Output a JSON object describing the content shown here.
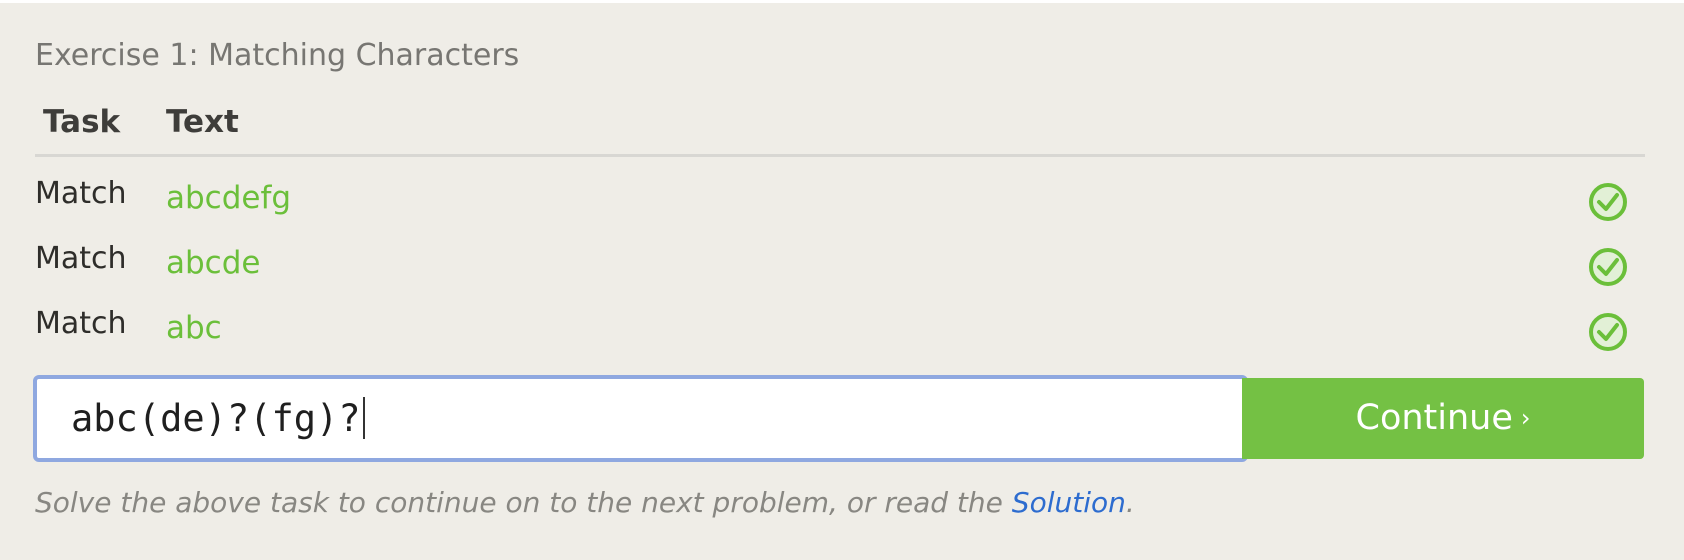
{
  "exercise": {
    "title": "Exercise 1: Matching Characters"
  },
  "table": {
    "headers": {
      "task": "Task",
      "text": "Text"
    },
    "rows": [
      {
        "task": "Match",
        "text": "abcdefg",
        "status": "check-circle-icon"
      },
      {
        "task": "Match",
        "text": "abcde",
        "status": "check-circle-icon"
      },
      {
        "task": "Match",
        "text": "abc",
        "status": "check-circle-icon"
      }
    ]
  },
  "input": {
    "value": "abc(de)?(fg)?"
  },
  "continue_button": {
    "label": "Continue",
    "chevron": "›"
  },
  "note": {
    "before": "Solve the above task to continue on to the next problem, or read the ",
    "link": "Solution",
    "after": "."
  },
  "colors": {
    "panel_bg": "#efede7",
    "match_text": "#6bbf3a",
    "button_bg": "#74c144",
    "link": "#2d6ccf",
    "input_border": "#8fa8e0"
  }
}
